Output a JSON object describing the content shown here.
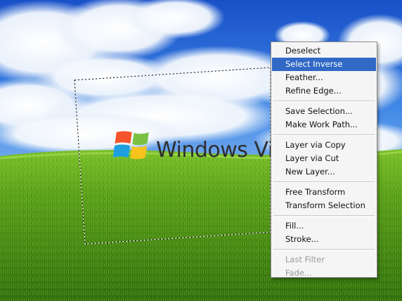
{
  "wallpaper": {
    "logo_text": "Windows Vis",
    "sky_top": "#1d5fd1",
    "grass": "#5aa019",
    "flag_colors": [
      "#f4542c",
      "#7ac142",
      "#1e9fe0",
      "#f8c21c"
    ]
  },
  "context_menu": {
    "groups": [
      [
        {
          "label": "Deselect",
          "state": "normal"
        },
        {
          "label": "Select Inverse",
          "state": "highlighted"
        },
        {
          "label": "Feather...",
          "state": "normal"
        },
        {
          "label": "Refine Edge...",
          "state": "normal"
        }
      ],
      [
        {
          "label": "Save Selection...",
          "state": "normal"
        },
        {
          "label": "Make Work Path...",
          "state": "normal"
        }
      ],
      [
        {
          "label": "Layer via Copy",
          "state": "normal"
        },
        {
          "label": "Layer via Cut",
          "state": "normal"
        },
        {
          "label": "New Layer...",
          "state": "normal"
        }
      ],
      [
        {
          "label": "Free Transform",
          "state": "normal"
        },
        {
          "label": "Transform Selection",
          "state": "normal"
        }
      ],
      [
        {
          "label": "Fill...",
          "state": "normal"
        },
        {
          "label": "Stroke...",
          "state": "normal"
        }
      ],
      [
        {
          "label": "Last Filter",
          "state": "disabled"
        },
        {
          "label": "Fade...",
          "state": "disabled"
        }
      ]
    ],
    "highlight_color": "#3169c6"
  }
}
